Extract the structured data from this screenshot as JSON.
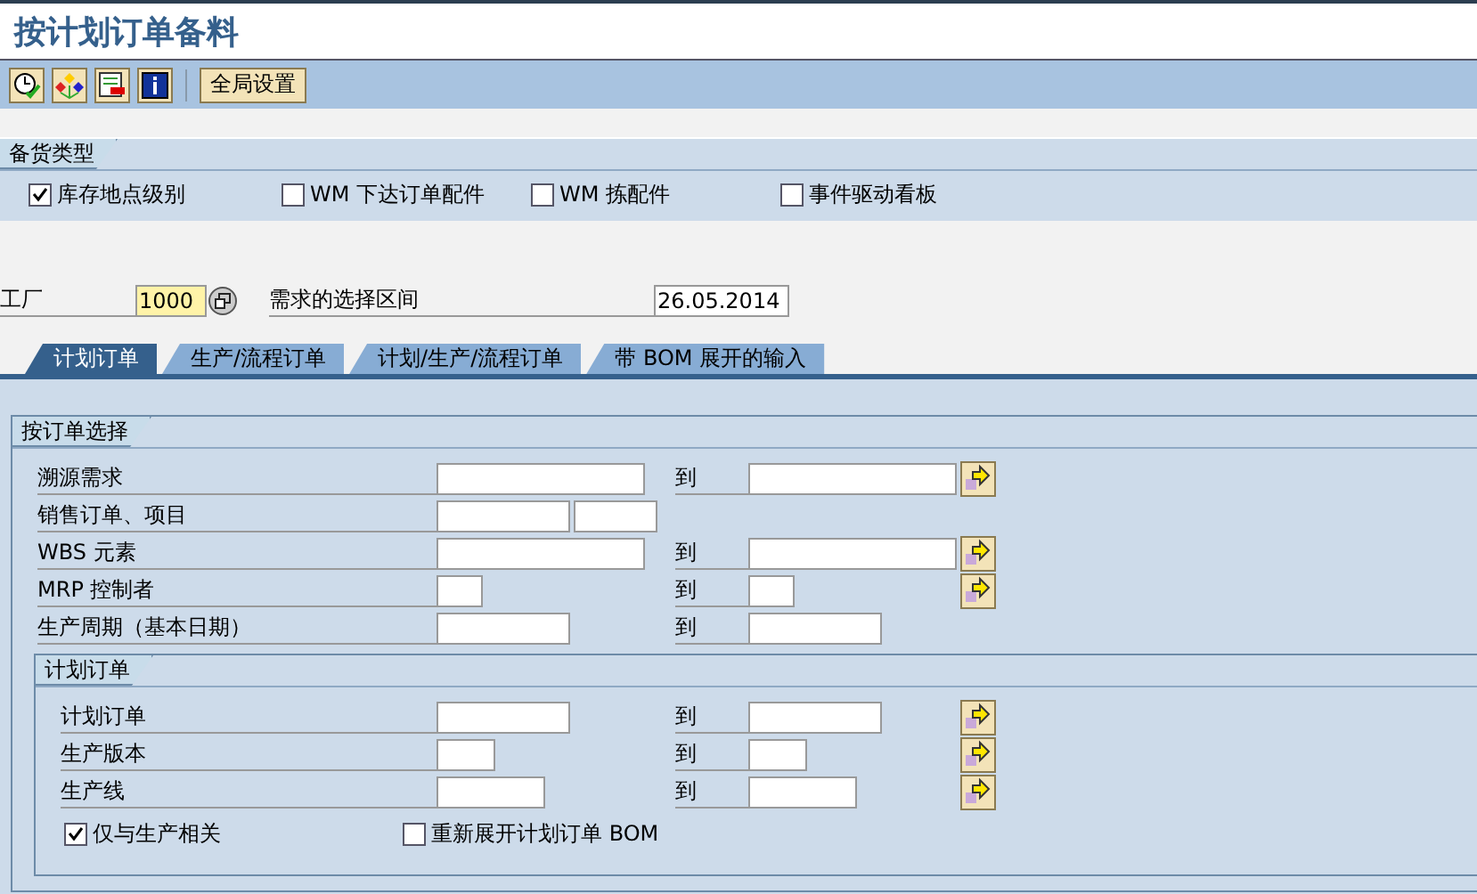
{
  "window": {
    "title": "按计划订单备料"
  },
  "toolbar": {
    "buttons": [
      "全局设置"
    ]
  },
  "stock_types": {
    "title": "备货类型",
    "options": [
      {
        "label": "库存地点级别",
        "checked": true
      },
      {
        "label": "WM 下达订单配件",
        "checked": false
      },
      {
        "label": "WM 拣配件",
        "checked": false
      },
      {
        "label": "事件驱动看板",
        "checked": false
      }
    ]
  },
  "plant": {
    "label": "工厂",
    "value": "1000"
  },
  "period": {
    "label": "需求的选择区间",
    "value": "26.05.2014"
  },
  "tabs": [
    {
      "label": "计划订单",
      "selected": true
    },
    {
      "label": "生产/流程订单",
      "selected": false
    },
    {
      "label": "计划/生产/流程订单",
      "selected": false
    },
    {
      "label": "带 BOM 展开的输入",
      "selected": false
    }
  ],
  "order_selection": {
    "title": "按订单选择",
    "rows": [
      {
        "kind": "range",
        "label": "溯源需求",
        "to_label": "到",
        "multiple_selection": true
      },
      {
        "kind": "pair",
        "label": "销售订单、项目"
      },
      {
        "kind": "range",
        "label": "WBS 元素",
        "to_label": "到",
        "multiple_selection": true
      },
      {
        "kind": "range",
        "label": "MRP 控制者",
        "to_label": "到",
        "multiple_selection": true
      },
      {
        "kind": "range",
        "label": "生产周期（基本日期）",
        "to_label": "到",
        "multiple_selection": false
      }
    ]
  },
  "planned_orders": {
    "title": "计划订单",
    "rows": [
      {
        "kind": "range",
        "label": "计划订单",
        "to_label": "到",
        "multiple_selection": true
      },
      {
        "kind": "range",
        "label": "生产版本",
        "to_label": "到",
        "multiple_selection": true
      },
      {
        "kind": "range",
        "label": "生产线",
        "to_label": "到",
        "multiple_selection": true
      }
    ],
    "options": [
      {
        "label": "仅与生产相关",
        "checked": true
      },
      {
        "label": "重新展开计划订单 BOM",
        "checked": false
      }
    ]
  }
}
